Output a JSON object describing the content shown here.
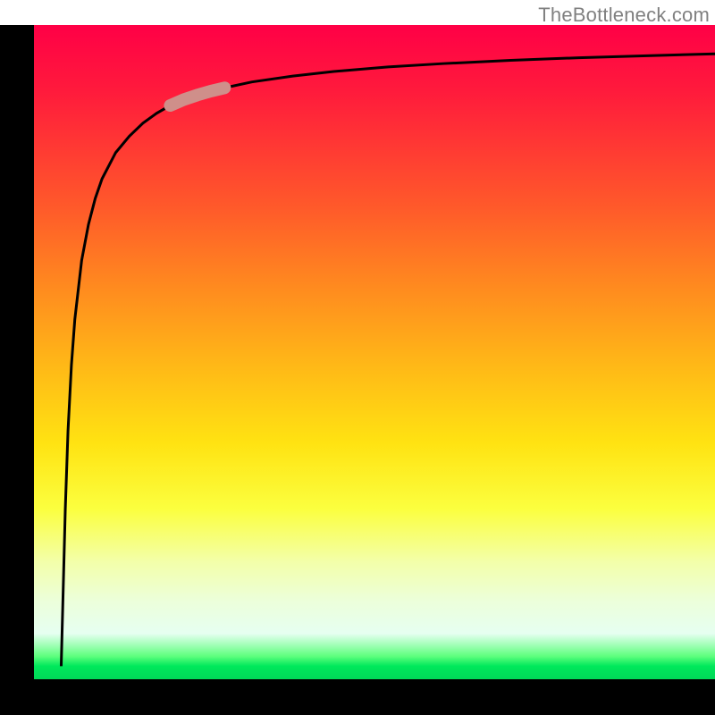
{
  "watermark": "TheBottleneck.com",
  "chart_data": {
    "type": "line",
    "title": "",
    "xlabel": "",
    "ylabel": "",
    "xlim": [
      0,
      100
    ],
    "ylim": [
      0,
      100
    ],
    "grid": false,
    "legend": false,
    "series": [
      {
        "name": "curve",
        "x": [
          4.0,
          4.3,
          4.6,
          5.0,
          5.5,
          6.0,
          7.0,
          8.0,
          9.0,
          10.0,
          12.0,
          14.0,
          16.0,
          18.0,
          20.0,
          24.0,
          28.0,
          32.0,
          38.0,
          44.0,
          52.0,
          60.0,
          70.0,
          80.0,
          90.0,
          100.0
        ],
        "y": [
          2.0,
          14.0,
          26.0,
          38.0,
          48.0,
          55.0,
          64.0,
          69.5,
          73.5,
          76.5,
          80.5,
          83.0,
          85.0,
          86.5,
          87.7,
          89.3,
          90.4,
          91.3,
          92.2,
          92.9,
          93.6,
          94.1,
          94.6,
          95.0,
          95.3,
          95.6
        ],
        "stroke": "#000000",
        "stroke_width": 3
      },
      {
        "name": "highlight-segment",
        "x": [
          20.0,
          22.0,
          24.0,
          26.0,
          28.0
        ],
        "y": [
          87.7,
          88.6,
          89.3,
          89.9,
          90.4
        ],
        "stroke": "#cf8f8a",
        "stroke_width": 14,
        "linecap": "round"
      }
    ],
    "gradient_stops": [
      {
        "pos": 0.0,
        "color": "#ff0046"
      },
      {
        "pos": 0.28,
        "color": "#ff5a2a"
      },
      {
        "pos": 0.52,
        "color": "#ffb817"
      },
      {
        "pos": 0.74,
        "color": "#fbff3f"
      },
      {
        "pos": 0.93,
        "color": "#e6fff1"
      },
      {
        "pos": 1.0,
        "color": "#00d858"
      }
    ]
  }
}
